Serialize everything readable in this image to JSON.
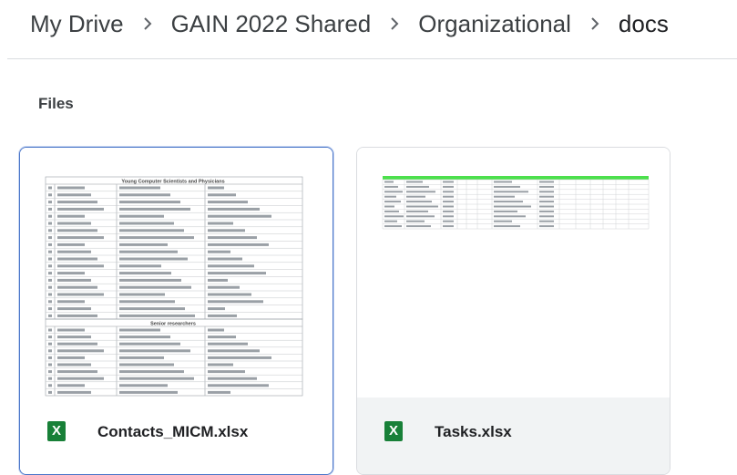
{
  "breadcrumb": {
    "items": [
      "My Drive",
      "GAIN 2022 Shared",
      "Organizational",
      "docs"
    ]
  },
  "section": {
    "title": "Files"
  },
  "files": [
    {
      "name": "Contacts_MICM.xlsx",
      "icon": "sheets-icon",
      "icon_letter": "X",
      "selected": true,
      "preview": {
        "table1_title": "Young Computer Scientists and Physicians",
        "table2_title": "Senior researchers"
      }
    },
    {
      "name": "Tasks.xlsx",
      "icon": "sheets-icon",
      "icon_letter": "X",
      "selected": false
    }
  ],
  "colors": {
    "sheets_green": "#188038",
    "selected_border": "#4a76c9",
    "preview_header_green": "#4ce04c"
  }
}
